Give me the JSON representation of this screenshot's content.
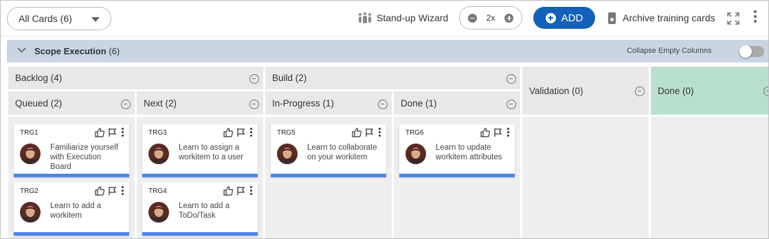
{
  "toolbar": {
    "filter_label": "All Cards (6)",
    "wizard_label": "Stand-up Wizard",
    "zoom_value": "2x",
    "add_label": "ADD",
    "archive_label": "Archive training cards",
    "icons": {
      "wizard": "people-icon",
      "zoom_out": "minus-circle-icon",
      "zoom_in": "plus-circle-icon",
      "add": "plus-circle-icon",
      "archive": "archive-icon",
      "expand": "expand-icon",
      "more": "more-vertical-icon"
    },
    "accent": "#1560b8"
  },
  "lane": {
    "title": "Scope Execution",
    "count": "(6)",
    "collapse_label": "Collapse Empty Columns",
    "collapse_on": false,
    "color": "#c9d5e3"
  },
  "groups": {
    "backlog": "Backlog (4)",
    "build": "Build (2)"
  },
  "columns": {
    "queued": "Queued (2)",
    "next": "Next (2)",
    "in_progress": "In-Progress (1)",
    "done_build": "Done (1)",
    "validation": "Validation (0)",
    "done": "Done (0)",
    "done_color": "#b9e0cc"
  },
  "cards": [
    {
      "id": "TRG1",
      "text": "Familiarize yourself with Execution Board",
      "column": "Queued"
    },
    {
      "id": "TRG2",
      "text": "Learn to add a workitem",
      "column": "Queued"
    },
    {
      "id": "TRG3",
      "text": "Learn to assign a workitem to a user",
      "column": "Next"
    },
    {
      "id": "TRG4",
      "text": "Learn to add a ToDo/Task",
      "column": "Next"
    },
    {
      "id": "TRG5",
      "text": "Learn to collaborate on your workitem",
      "column": "In-Progress"
    },
    {
      "id": "TRG6",
      "text": "Learn to update workitem attributes",
      "column": "Done"
    }
  ],
  "card_icons": [
    "thumbs-up-icon",
    "flag-icon",
    "more-vertical-icon"
  ],
  "card_bar_color": "#4a86e8"
}
